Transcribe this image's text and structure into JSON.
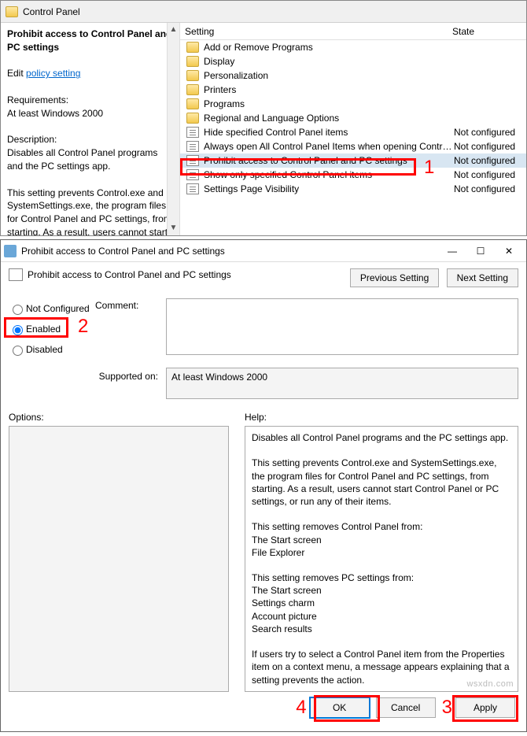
{
  "gpe": {
    "header_title": "Control Panel",
    "columns": {
      "setting": "Setting",
      "state": "State"
    },
    "left": {
      "title": "Prohibit access to Control Panel and PC settings",
      "edit_prefix": "Edit ",
      "edit_link": "policy setting ",
      "req_label": "Requirements:",
      "req_value": "At least Windows 2000",
      "desc_label": "Description:",
      "desc_1": "Disables all Control Panel programs and the PC settings app.",
      "desc_2": "This setting prevents Control.exe and SystemSettings.exe, the program files for Control Panel and PC settings, from starting. As a result, users cannot start Control"
    },
    "rows": [
      {
        "type": "folder",
        "label": "Add or Remove Programs",
        "state": ""
      },
      {
        "type": "folder",
        "label": "Display",
        "state": ""
      },
      {
        "type": "folder",
        "label": "Personalization",
        "state": ""
      },
      {
        "type": "folder",
        "label": "Printers",
        "state": ""
      },
      {
        "type": "folder",
        "label": "Programs",
        "state": ""
      },
      {
        "type": "folder",
        "label": "Regional and Language Options",
        "state": ""
      },
      {
        "type": "setting",
        "label": "Hide specified Control Panel items",
        "state": "Not configured"
      },
      {
        "type": "setting",
        "label": "Always open All Control Panel Items when opening Control ...",
        "state": "Not configured"
      },
      {
        "type": "setting",
        "label": "Prohibit access to Control Panel and PC settings",
        "state": "Not configured",
        "selected": true
      },
      {
        "type": "setting",
        "label": "Show only specified Control Panel items",
        "state": "Not configured"
      },
      {
        "type": "setting",
        "label": "Settings Page Visibility",
        "state": "Not configured"
      }
    ],
    "annotations": {
      "one": "1"
    }
  },
  "dlg": {
    "title": "Prohibit access to Control Panel and PC settings",
    "subtitle": "Prohibit access to Control Panel and PC settings",
    "nav": {
      "prev": "Previous Setting",
      "next": "Next Setting"
    },
    "radios": {
      "not_configured": "Not Configured",
      "enabled": "Enabled",
      "disabled": "Disabled"
    },
    "comment_label": "Comment:",
    "comment_value": "",
    "supported_label": "Supported on:",
    "supported_value": "At least Windows 2000",
    "options_label": "Options:",
    "help_label": "Help:",
    "help_text": "Disables all Control Panel programs and the PC settings app.\n\nThis setting prevents Control.exe and SystemSettings.exe, the program files for Control Panel and PC settings, from starting. As a result, users cannot start Control Panel or PC settings, or run any of their items.\n\nThis setting removes Control Panel from:\nThe Start screen\nFile Explorer\n\nThis setting removes PC settings from:\nThe Start screen\nSettings charm\nAccount picture\nSearch results\n\nIf users try to select a Control Panel item from the Properties item on a context menu, a message appears explaining that a setting prevents the action.",
    "buttons": {
      "ok": "OK",
      "cancel": "Cancel",
      "apply": "Apply"
    },
    "annotations": {
      "two": "2",
      "three": "3",
      "four": "4"
    },
    "watermark": "wsxdn.com"
  }
}
